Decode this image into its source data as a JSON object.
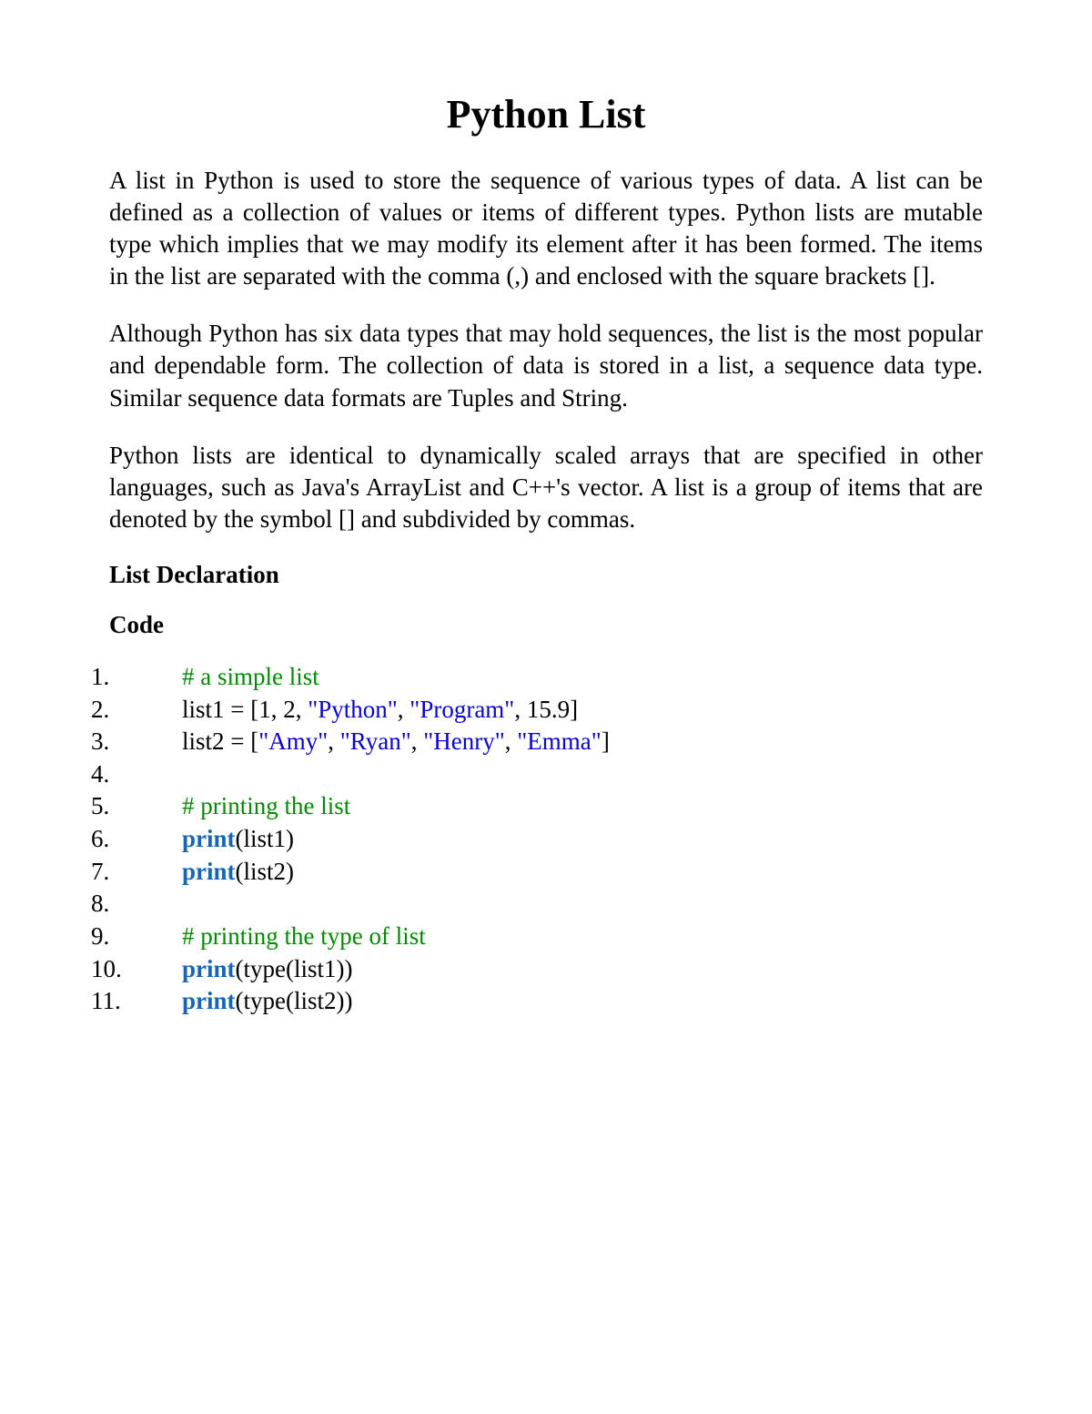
{
  "title": "Python List",
  "paragraphs": [
    "A list in Python is used to store the sequence of various types of data. A list can be defined as a collection of values or items of different types. Python lists are mutable type which implies that we may modify its element after it has been formed. The items in the list are separated with the comma (,) and enclosed with the square brackets [].",
    "Although Python has six data types that may hold sequences, the list is the most popular and dependable form. The collection of data is stored in a list, a sequence data type. Similar sequence data formats are Tuples and String.",
    "Python lists are identical to dynamically scaled arrays that are specified in other languages, such as Java's ArrayList and C++'s vector. A list is a group of items that are denoted by the symbol [] and subdivided by commas."
  ],
  "headings": {
    "declaration": "List Declaration",
    "code": "Code"
  },
  "code": {
    "lines": [
      {
        "num": "1.",
        "tokens": [
          {
            "cls": "comment",
            "t": "# a simple list"
          }
        ]
      },
      {
        "num": "2.",
        "tokens": [
          {
            "cls": "plain",
            "t": "list1 = [1, 2, "
          },
          {
            "cls": "string",
            "t": "\"Python\""
          },
          {
            "cls": "plain",
            "t": ", "
          },
          {
            "cls": "string",
            "t": "\"Program\""
          },
          {
            "cls": "plain",
            "t": ", 15.9]"
          }
        ]
      },
      {
        "num": "3.",
        "tokens": [
          {
            "cls": "plain",
            "t": "list2 = ["
          },
          {
            "cls": "string",
            "t": "\"Amy\""
          },
          {
            "cls": "plain",
            "t": ", "
          },
          {
            "cls": "string",
            "t": "\"Ryan\""
          },
          {
            "cls": "plain",
            "t": ", "
          },
          {
            "cls": "string",
            "t": "\"Henry\""
          },
          {
            "cls": "plain",
            "t": ", "
          },
          {
            "cls": "string",
            "t": "\"Emma\""
          },
          {
            "cls": "plain",
            "t": "]"
          }
        ]
      },
      {
        "num": "4.",
        "tokens": []
      },
      {
        "num": "5.",
        "tokens": [
          {
            "cls": "comment",
            "t": "# printing the list"
          }
        ]
      },
      {
        "num": "6.",
        "tokens": [
          {
            "cls": "keyword",
            "t": "print"
          },
          {
            "cls": "plain",
            "t": "(list1)"
          }
        ]
      },
      {
        "num": "7.",
        "tokens": [
          {
            "cls": "keyword",
            "t": "print"
          },
          {
            "cls": "plain",
            "t": "(list2)"
          }
        ]
      },
      {
        "num": "8.",
        "tokens": []
      },
      {
        "num": "9.",
        "tokens": [
          {
            "cls": "comment",
            "t": "# printing the type of list"
          }
        ]
      },
      {
        "num": "10.",
        "tokens": [
          {
            "cls": "keyword",
            "t": "print"
          },
          {
            "cls": "plain",
            "t": "(type(list1))"
          }
        ]
      },
      {
        "num": "11.",
        "tokens": [
          {
            "cls": "keyword",
            "t": "print"
          },
          {
            "cls": "plain",
            "t": "(type(list2))"
          }
        ]
      }
    ]
  }
}
